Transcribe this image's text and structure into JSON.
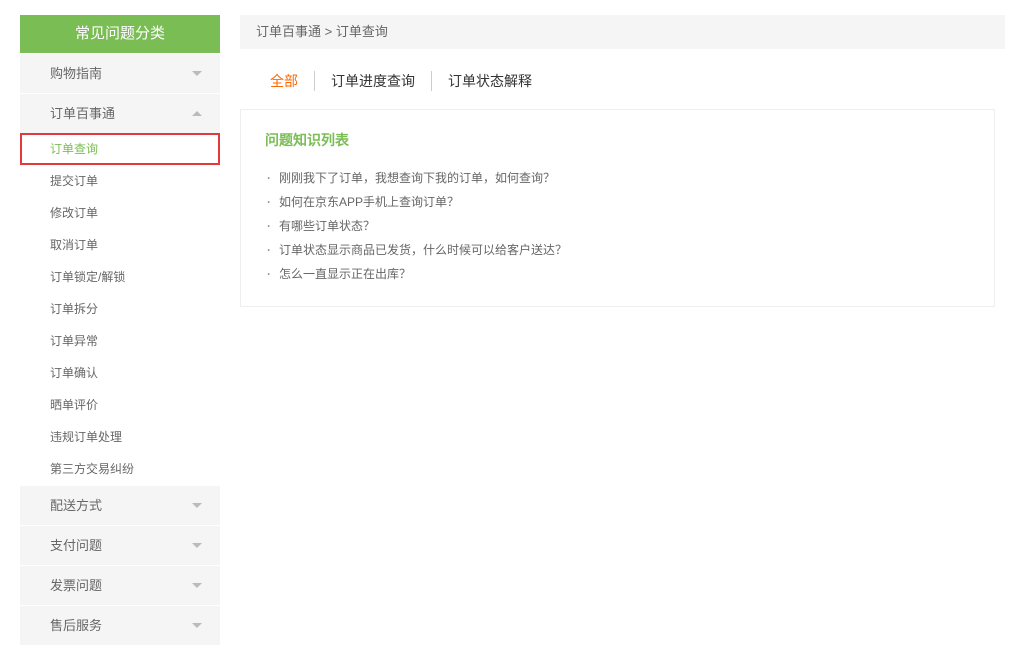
{
  "sidebar": {
    "header": "常见问题分类",
    "categories": [
      {
        "label": "购物指南",
        "expanded": false
      },
      {
        "label": "订单百事通",
        "expanded": true
      },
      {
        "label": "配送方式",
        "expanded": false
      },
      {
        "label": "支付问题",
        "expanded": false
      },
      {
        "label": "发票问题",
        "expanded": false
      },
      {
        "label": "售后服务",
        "expanded": false
      }
    ],
    "subItems": [
      {
        "label": "订单查询",
        "active": true
      },
      {
        "label": "提交订单",
        "active": false
      },
      {
        "label": "修改订单",
        "active": false
      },
      {
        "label": "取消订单",
        "active": false
      },
      {
        "label": "订单锁定/解锁",
        "active": false
      },
      {
        "label": "订单拆分",
        "active": false
      },
      {
        "label": "订单异常",
        "active": false
      },
      {
        "label": "订单确认",
        "active": false
      },
      {
        "label": "晒单评价",
        "active": false
      },
      {
        "label": "违规订单处理",
        "active": false
      },
      {
        "label": "第三方交易纠纷",
        "active": false
      }
    ]
  },
  "breadcrumb": {
    "part1": "订单百事通",
    "sep": " > ",
    "part2": "订单查询"
  },
  "tabs": [
    {
      "label": "全部",
      "active": true
    },
    {
      "label": "订单进度查询",
      "active": false
    },
    {
      "label": "订单状态解释",
      "active": false
    }
  ],
  "faq": {
    "title": "问题知识列表",
    "items": [
      "刚刚我下了订单，我想查询下我的订单，如何查询？",
      "如何在京东APP手机上查询订单？",
      "有哪些订单状态？",
      "订单状态显示商品已发货，什么时候可以给客户送达？",
      "怎么一直显示正在出库？"
    ]
  }
}
